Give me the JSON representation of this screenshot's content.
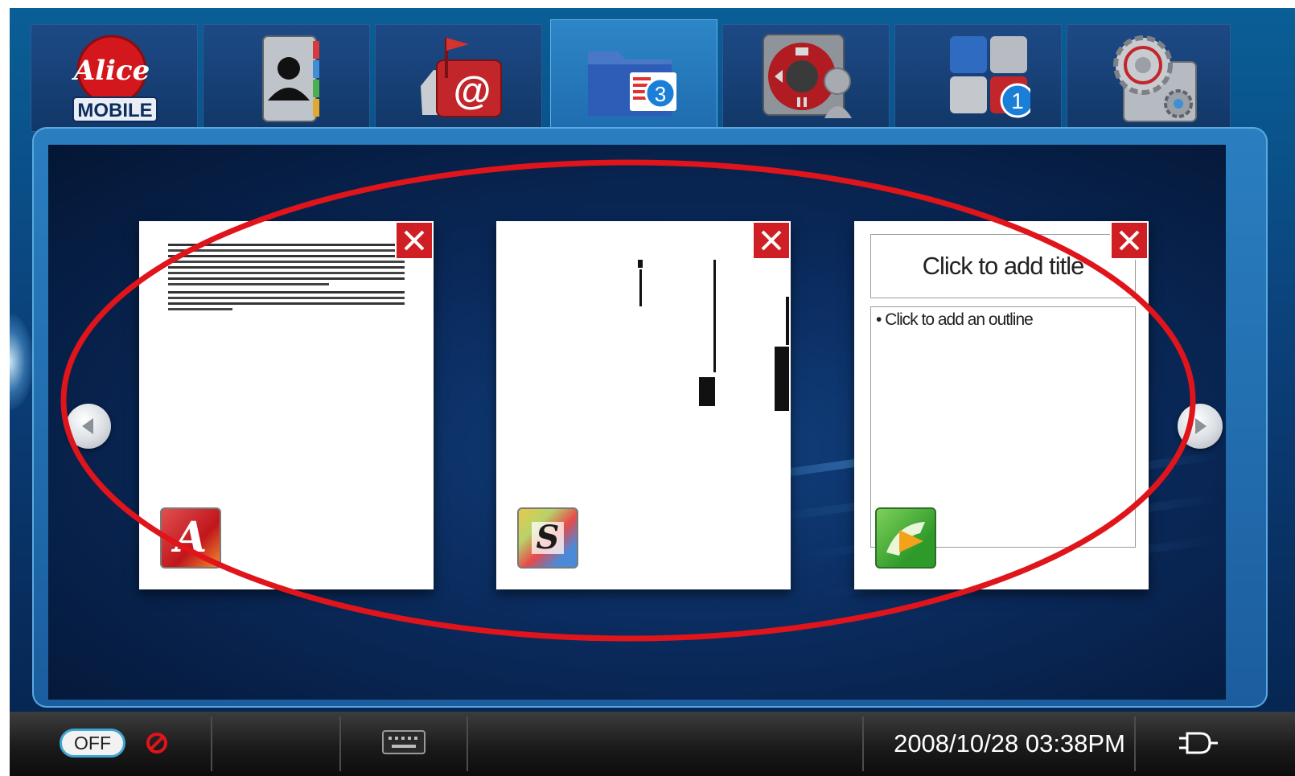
{
  "tabs": [
    {
      "name": "Alice Mobile",
      "icon": "alice-mobile-logo",
      "logo_text_top": "Alice",
      "logo_text_bottom": "MOBILE",
      "active": false
    },
    {
      "name": "Contacts",
      "icon": "contacts-icon",
      "active": false
    },
    {
      "name": "Mail",
      "icon": "mail-icon",
      "active": false
    },
    {
      "name": "Documents",
      "icon": "documents-folder-icon",
      "badge": "3",
      "active": true
    },
    {
      "name": "Media",
      "icon": "media-player-icon",
      "active": false
    },
    {
      "name": "Applications",
      "icon": "apps-grid-icon",
      "badge": "1",
      "active": false
    },
    {
      "name": "Settings",
      "icon": "settings-gear-icon",
      "active": false
    }
  ],
  "documents": [
    {
      "type": "text document",
      "app_icon": "text-editor-app-icon",
      "app_letter": "A",
      "close_icon": "close-icon"
    },
    {
      "type": "spreadsheet",
      "app_icon": "spreadsheet-app-icon",
      "app_letter": "S",
      "close_icon": "close-icon"
    },
    {
      "type": "presentation",
      "app_icon": "presentation-app-icon",
      "title_placeholder": "Click to add title",
      "outline_placeholder": "• Click to add an outline",
      "close_icon": "close-icon"
    }
  ],
  "navigation": {
    "prev_icon": "arrow-left-icon",
    "next_icon": "arrow-right-icon"
  },
  "statusbar": {
    "toggle_label": "OFF",
    "blocked_icon": "no-entry-icon",
    "keyboard_icon": "keyboard-icon",
    "datetime": "2008/10/28 03:38PM",
    "power_icon": "power-plug-icon"
  },
  "colors": {
    "accent": "#1d6aad",
    "close_red": "#cf1f24",
    "badge_blue": "#1b7fd8",
    "annotation_red": "#e0141b"
  }
}
